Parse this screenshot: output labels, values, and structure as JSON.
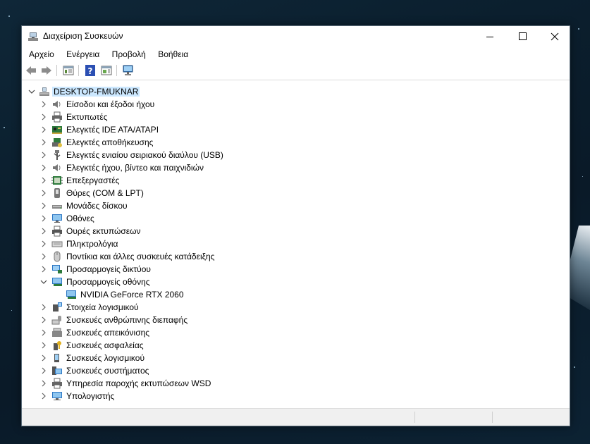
{
  "window": {
    "title": "Διαχείριση Συσκευών",
    "controls": {
      "minimize": "minimize",
      "maximize": "maximize",
      "close": "close"
    }
  },
  "menu": [
    "Αρχείο",
    "Ενέργεια",
    "Προβολή",
    "Βοήθεια"
  ],
  "toolbar": {
    "buttons": [
      "back-arrow-icon",
      "forward-arrow-icon",
      "properties-icon",
      "help-icon",
      "view-icon",
      "scan-hardware-icon"
    ]
  },
  "tree": {
    "root": "DESKTOP-FMUKNAR",
    "categories": [
      {
        "label": "Είσοδοι και έξοδοι ήχου",
        "icon": "speaker-icon",
        "expanded": false
      },
      {
        "label": "Εκτυπωτές",
        "icon": "printer-icon",
        "expanded": false
      },
      {
        "label": "Ελεγκτές IDE ATA/ATAPI",
        "icon": "ide-controller-icon",
        "expanded": false
      },
      {
        "label": "Ελεγκτές αποθήκευσης",
        "icon": "storage-controller-icon",
        "expanded": false
      },
      {
        "label": "Ελεγκτές ενιαίου σειριακού διαύλου (USB)",
        "icon": "usb-icon",
        "expanded": false
      },
      {
        "label": "Ελεγκτές ήχου, βίντεο και παιχνιδιών",
        "icon": "speaker-icon",
        "expanded": false
      },
      {
        "label": "Επεξεργαστές",
        "icon": "cpu-icon",
        "expanded": false
      },
      {
        "label": "Θύρες (COM & LPT)",
        "icon": "port-icon",
        "expanded": false
      },
      {
        "label": "Μονάδες δίσκου",
        "icon": "disk-drive-icon",
        "expanded": false
      },
      {
        "label": "Οθόνες",
        "icon": "monitor-icon",
        "expanded": false
      },
      {
        "label": "Ουρές εκτυπώσεων",
        "icon": "print-queue-icon",
        "expanded": false
      },
      {
        "label": "Πληκτρολόγια",
        "icon": "keyboard-icon",
        "expanded": false
      },
      {
        "label": "Ποντίκια και άλλες συσκευές κατάδειξης",
        "icon": "mouse-icon",
        "expanded": false
      },
      {
        "label": "Προσαρμογείς δικτύου",
        "icon": "network-adapter-icon",
        "expanded": false
      },
      {
        "label": "Προσαρμογείς οθόνης",
        "icon": "display-adapter-icon",
        "expanded": true,
        "children": [
          "NVIDIA GeForce RTX 2060"
        ]
      },
      {
        "label": "Στοιχεία λογισμικού",
        "icon": "software-component-icon",
        "expanded": false
      },
      {
        "label": "Συσκευές ανθρώπινης διεπαφής",
        "icon": "hid-icon",
        "expanded": false
      },
      {
        "label": "Συσκευές απεικόνισης",
        "icon": "imaging-device-icon",
        "expanded": false
      },
      {
        "label": "Συσκευές ασφαλείας",
        "icon": "security-key-icon",
        "expanded": false
      },
      {
        "label": "Συσκευές λογισμικού",
        "icon": "software-device-icon",
        "expanded": false
      },
      {
        "label": "Συσκευές συστήματος",
        "icon": "system-device-icon",
        "expanded": false
      },
      {
        "label": "Υπηρεσία παροχής εκτυπώσεων WSD",
        "icon": "printer-icon",
        "expanded": false
      },
      {
        "label": "Υπολογιστής",
        "icon": "computer-icon",
        "expanded": false
      }
    ]
  },
  "colors": {
    "selection": "#cce8ff",
    "chevron": "#606060"
  }
}
